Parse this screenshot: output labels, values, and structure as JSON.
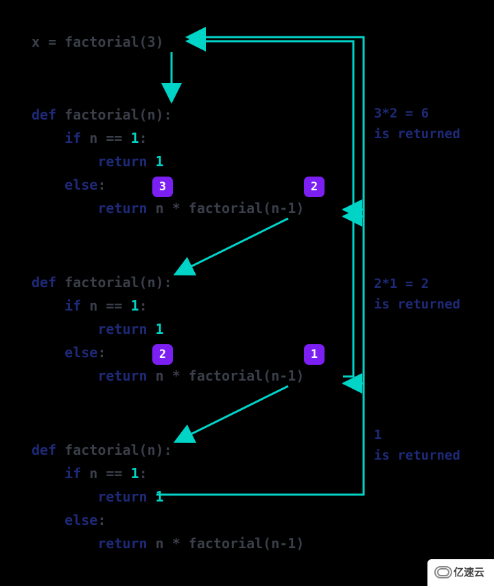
{
  "call_line": {
    "x": "x",
    "eq": " = ",
    "fn": "factorial",
    "open": "(",
    "arg": "3",
    "close": ")"
  },
  "block": {
    "def": "def",
    "sp": " ",
    "fn": "factorial",
    "sig_open": "(",
    "n": "n",
    "sig_close": "):",
    "if": "if",
    "cond_pre": " n == ",
    "one": "1",
    "colon": ":",
    "ret": "return",
    "ret_sp": " ",
    "ret1": "1",
    "else": "else",
    "else_colon": ":",
    "ret2": "return",
    "expr_pre": " n * ",
    "call": "factorial",
    "call_open": "(",
    "call_arg": "n-1",
    "call_close": ")"
  },
  "annots": [
    {
      "line1": "3*2 = 6",
      "line2": "is returned"
    },
    {
      "line1": "2*1 = 2",
      "line2": "is returned"
    },
    {
      "line1": "1",
      "line2": "is returned"
    }
  ],
  "badges": [
    {
      "n": "3"
    },
    {
      "n": "2"
    },
    {
      "n": "2"
    },
    {
      "n": "1"
    }
  ],
  "watermark": "亿速云",
  "chart_data": {
    "type": "diagram",
    "title": "Recursive factorial(3) call trace",
    "call": "x = factorial(3)",
    "steps": [
      {
        "level": 1,
        "n": 3,
        "recurse_with": 2,
        "returns": "3*2 = 6"
      },
      {
        "level": 2,
        "n": 2,
        "recurse_with": 1,
        "returns": "2*1 = 2"
      },
      {
        "level": 3,
        "n": 1,
        "base_case": true,
        "returns": "1"
      }
    ],
    "function_source": "def factorial(n):\n    if n == 1:\n        return 1\n    else:\n        return n * factorial(n-1)"
  }
}
